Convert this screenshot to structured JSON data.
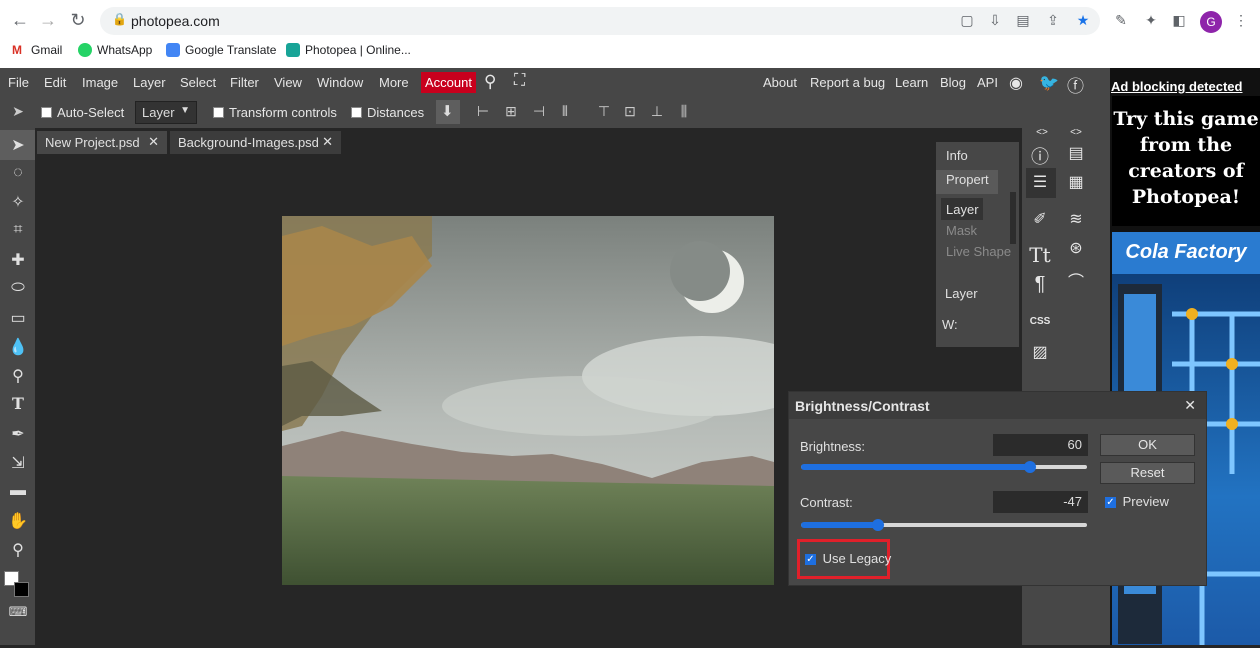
{
  "browser": {
    "url": "photopea.com",
    "bookmarks": [
      "Gmail",
      "WhatsApp",
      "Google Translate",
      "Photopea | Online..."
    ],
    "profile_initial": "G"
  },
  "menu": {
    "items": [
      "File",
      "Edit",
      "Image",
      "Layer",
      "Select",
      "Filter",
      "View",
      "Window",
      "More"
    ],
    "account": "Account",
    "right_links": [
      "About",
      "Report a bug",
      "Learn",
      "Blog",
      "API"
    ]
  },
  "toolbar": {
    "auto_select": "Auto-Select",
    "layer_select": "Layer",
    "transform_controls": "Transform controls",
    "distances": "Distances"
  },
  "tabs": [
    {
      "label": "New Project.psd"
    },
    {
      "label": "Background-Images.psd"
    }
  ],
  "panel": {
    "info": "Info",
    "properties": "Propert",
    "layer_tab": "Layer",
    "mask_tab": "Mask",
    "live_shape_tab": "Live Shape",
    "layer_heading": "Layer",
    "w_label": "W:",
    "css_label": "CSS"
  },
  "dialog": {
    "title": "Brightness/Contrast",
    "brightness_label": "Brightness:",
    "brightness_value": "60",
    "contrast_label": "Contrast:",
    "contrast_value": "-47",
    "ok": "OK",
    "reset": "Reset",
    "preview": "Preview",
    "use_legacy": "Use Legacy",
    "brightness_level": 0.8,
    "contrast_level": 0.27
  },
  "ad": {
    "blocking_link": "Ad blocking detected",
    "title": "Try this game from the creators of Photopea!",
    "game_logo": "Cola Factory"
  },
  "colors": {
    "accent_blue": "#1e6fe0",
    "account_red": "#c8001d",
    "highlight_red": "#e0202a"
  }
}
